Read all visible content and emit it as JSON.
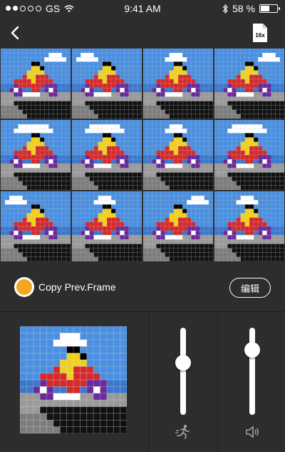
{
  "status": {
    "carrier": "GS",
    "time": "9:41 AM",
    "battery": "58 %"
  },
  "nav": {
    "speed_label": "16x"
  },
  "frames": [
    {
      "cloud": "right"
    },
    {
      "cloud": "left"
    },
    {
      "cloud": "mid"
    },
    {
      "cloud": "right"
    },
    {
      "cloud": "big"
    },
    {
      "cloud": "big"
    },
    {
      "cloud": "mid"
    },
    {
      "cloud": "big"
    },
    {
      "cloud": "left"
    },
    {
      "cloud": "mid"
    },
    {
      "cloud": "right"
    },
    {
      "cloud": "mid"
    }
  ],
  "controls": {
    "copy_label": "Copy Prev.Frame",
    "edit_label": "编辑"
  },
  "sliders": {
    "speed_level": 0.6,
    "volume_level": 0.75
  },
  "icons": {
    "back": "chevron-left-icon",
    "speed": "speed-badge-icon",
    "runner": "runner-icon",
    "volume": "speaker-icon"
  },
  "colors": {
    "accent": "#f5a623",
    "sky": "#4a8fe0",
    "background": "#2d2d2d"
  }
}
